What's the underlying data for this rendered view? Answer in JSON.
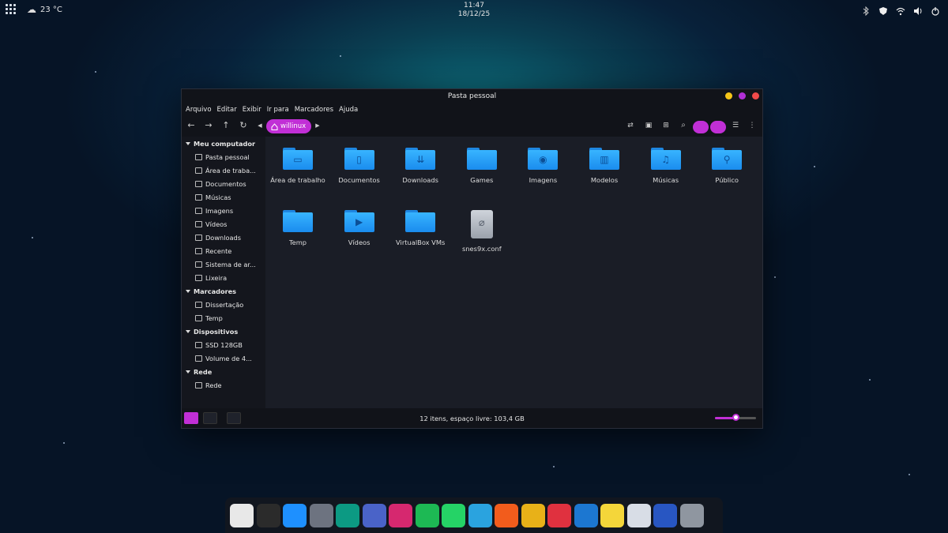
{
  "topbar": {
    "weather": {
      "temp": "23 °C",
      "icon": "partly-cloudy-icon"
    },
    "clock": {
      "time": "11:47",
      "date": "18/12/25"
    },
    "tray_icons": [
      "bluetooth-icon",
      "shield-icon",
      "wifi-icon",
      "volume-icon",
      "power-icon"
    ]
  },
  "window": {
    "title": "Pasta pessoal",
    "controls": [
      {
        "name": "minimize",
        "color": "#f5c518"
      },
      {
        "name": "maximize",
        "color": "#b02fd6"
      },
      {
        "name": "close",
        "color": "#f04a4a"
      }
    ],
    "menu": [
      "Arquivo",
      "Editar",
      "Exibir",
      "Ir para",
      "Marcadores",
      "Ajuda"
    ],
    "breadcrumb": "willinux",
    "accent": "#c12fd6"
  },
  "sidebar": {
    "sections": [
      {
        "title": "Meu computador",
        "items": [
          {
            "label": "Pasta pessoal",
            "icon": "home-icon"
          },
          {
            "label": "Área de traba...",
            "icon": "desktop-icon"
          },
          {
            "label": "Documentos",
            "icon": "document-icon"
          },
          {
            "label": "Músicas",
            "icon": "music-icon"
          },
          {
            "label": "Imagens",
            "icon": "image-icon"
          },
          {
            "label": "Vídeos",
            "icon": "video-icon"
          },
          {
            "label": "Downloads",
            "icon": "download-icon"
          },
          {
            "label": "Recente",
            "icon": "recent-icon"
          },
          {
            "label": "Sistema de ar...",
            "icon": "drive-icon"
          },
          {
            "label": "Lixeira",
            "icon": "trash-icon"
          }
        ]
      },
      {
        "title": "Marcadores",
        "items": [
          {
            "label": "Dissertação",
            "icon": "folder-icon"
          },
          {
            "label": "Temp",
            "icon": "folder-icon"
          }
        ]
      },
      {
        "title": "Dispositivos",
        "items": [
          {
            "label": "SSD 128GB",
            "icon": "drive-icon"
          },
          {
            "label": "Volume de 4...",
            "icon": "drive-icon"
          }
        ]
      },
      {
        "title": "Rede",
        "items": [
          {
            "label": "Rede",
            "icon": "network-icon"
          }
        ]
      }
    ]
  },
  "files": [
    {
      "name": "Área de trabalho",
      "type": "folder",
      "glyph": "▭"
    },
    {
      "name": "Documentos",
      "type": "folder",
      "glyph": "▯"
    },
    {
      "name": "Downloads",
      "type": "folder",
      "glyph": "⇊"
    },
    {
      "name": "Games",
      "type": "folder",
      "glyph": ""
    },
    {
      "name": "Imagens",
      "type": "folder",
      "glyph": "◉"
    },
    {
      "name": "Modelos",
      "type": "folder",
      "glyph": "▥"
    },
    {
      "name": "Músicas",
      "type": "folder",
      "glyph": "♫"
    },
    {
      "name": "Público",
      "type": "folder",
      "glyph": "⚲"
    },
    {
      "name": "Temp",
      "type": "folder",
      "glyph": ""
    },
    {
      "name": "Vídeos",
      "type": "folder",
      "glyph": "▶"
    },
    {
      "name": "VirtualBox VMs",
      "type": "folder",
      "glyph": ""
    },
    {
      "name": "snes9x.conf",
      "type": "file",
      "glyph": "⌀"
    }
  ],
  "status": {
    "text": "12 itens, espaço livre: 103,4 GB",
    "zoom_level": 0.5
  },
  "dock": [
    {
      "name": "settings-app",
      "color": "#e8e8e8"
    },
    {
      "name": "terminal-app",
      "color": "#2b2b2b"
    },
    {
      "name": "files-app",
      "color": "#1e90ff"
    },
    {
      "name": "calculator-app",
      "color": "#6d7380"
    },
    {
      "name": "aperture-app",
      "color": "#0c9a83"
    },
    {
      "name": "photos-app",
      "color": "#4a63c8"
    },
    {
      "name": "instagram-app",
      "color": "#d6286f"
    },
    {
      "name": "spotify-app",
      "color": "#1db954"
    },
    {
      "name": "whatsapp-app",
      "color": "#25d366"
    },
    {
      "name": "telegram-app",
      "color": "#2aa3df"
    },
    {
      "name": "brave-app",
      "color": "#f25c1c"
    },
    {
      "name": "chrome-app",
      "color": "#e8b118"
    },
    {
      "name": "vivaldi-app",
      "color": "#e0313f"
    },
    {
      "name": "remote-app",
      "color": "#1c77d1"
    },
    {
      "name": "notes-app",
      "color": "#f4d63a"
    },
    {
      "name": "text-editor-app",
      "color": "#d8dde6"
    },
    {
      "name": "writer-app",
      "color": "#2856c2"
    },
    {
      "name": "book-app",
      "color": "#8f96a0"
    }
  ]
}
